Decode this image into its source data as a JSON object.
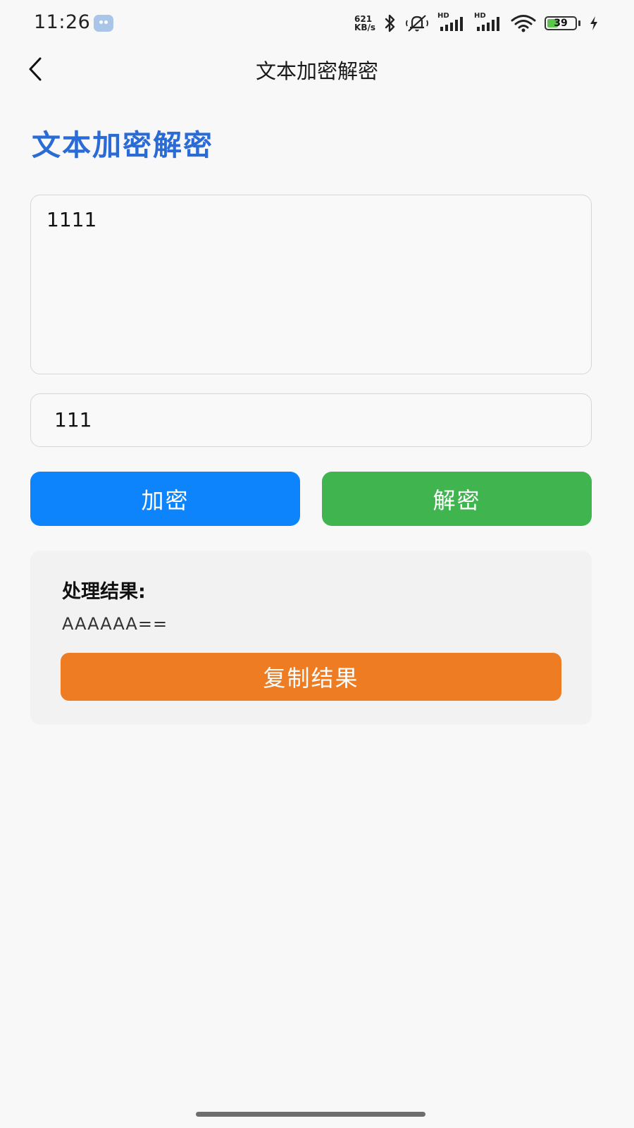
{
  "status_bar": {
    "time": "11:26",
    "net_speed_value": "621",
    "net_speed_unit": "KB/s",
    "signal_1_label": "HD",
    "signal_2_label": "HD",
    "battery_level": "39"
  },
  "nav": {
    "title": "文本加密解密"
  },
  "page": {
    "heading": "文本加密解密",
    "heading_color": "#2a6bd6"
  },
  "form": {
    "text_value": "1111",
    "key_value": "111"
  },
  "buttons": {
    "encrypt_label": "加密",
    "encrypt_color": "#0d84fb",
    "decrypt_label": "解密",
    "decrypt_color": "#3fb44f"
  },
  "result": {
    "label": "处理结果:",
    "value": "AAAAAA==",
    "copy_label": "复制结果",
    "copy_color": "#ee7c23"
  }
}
